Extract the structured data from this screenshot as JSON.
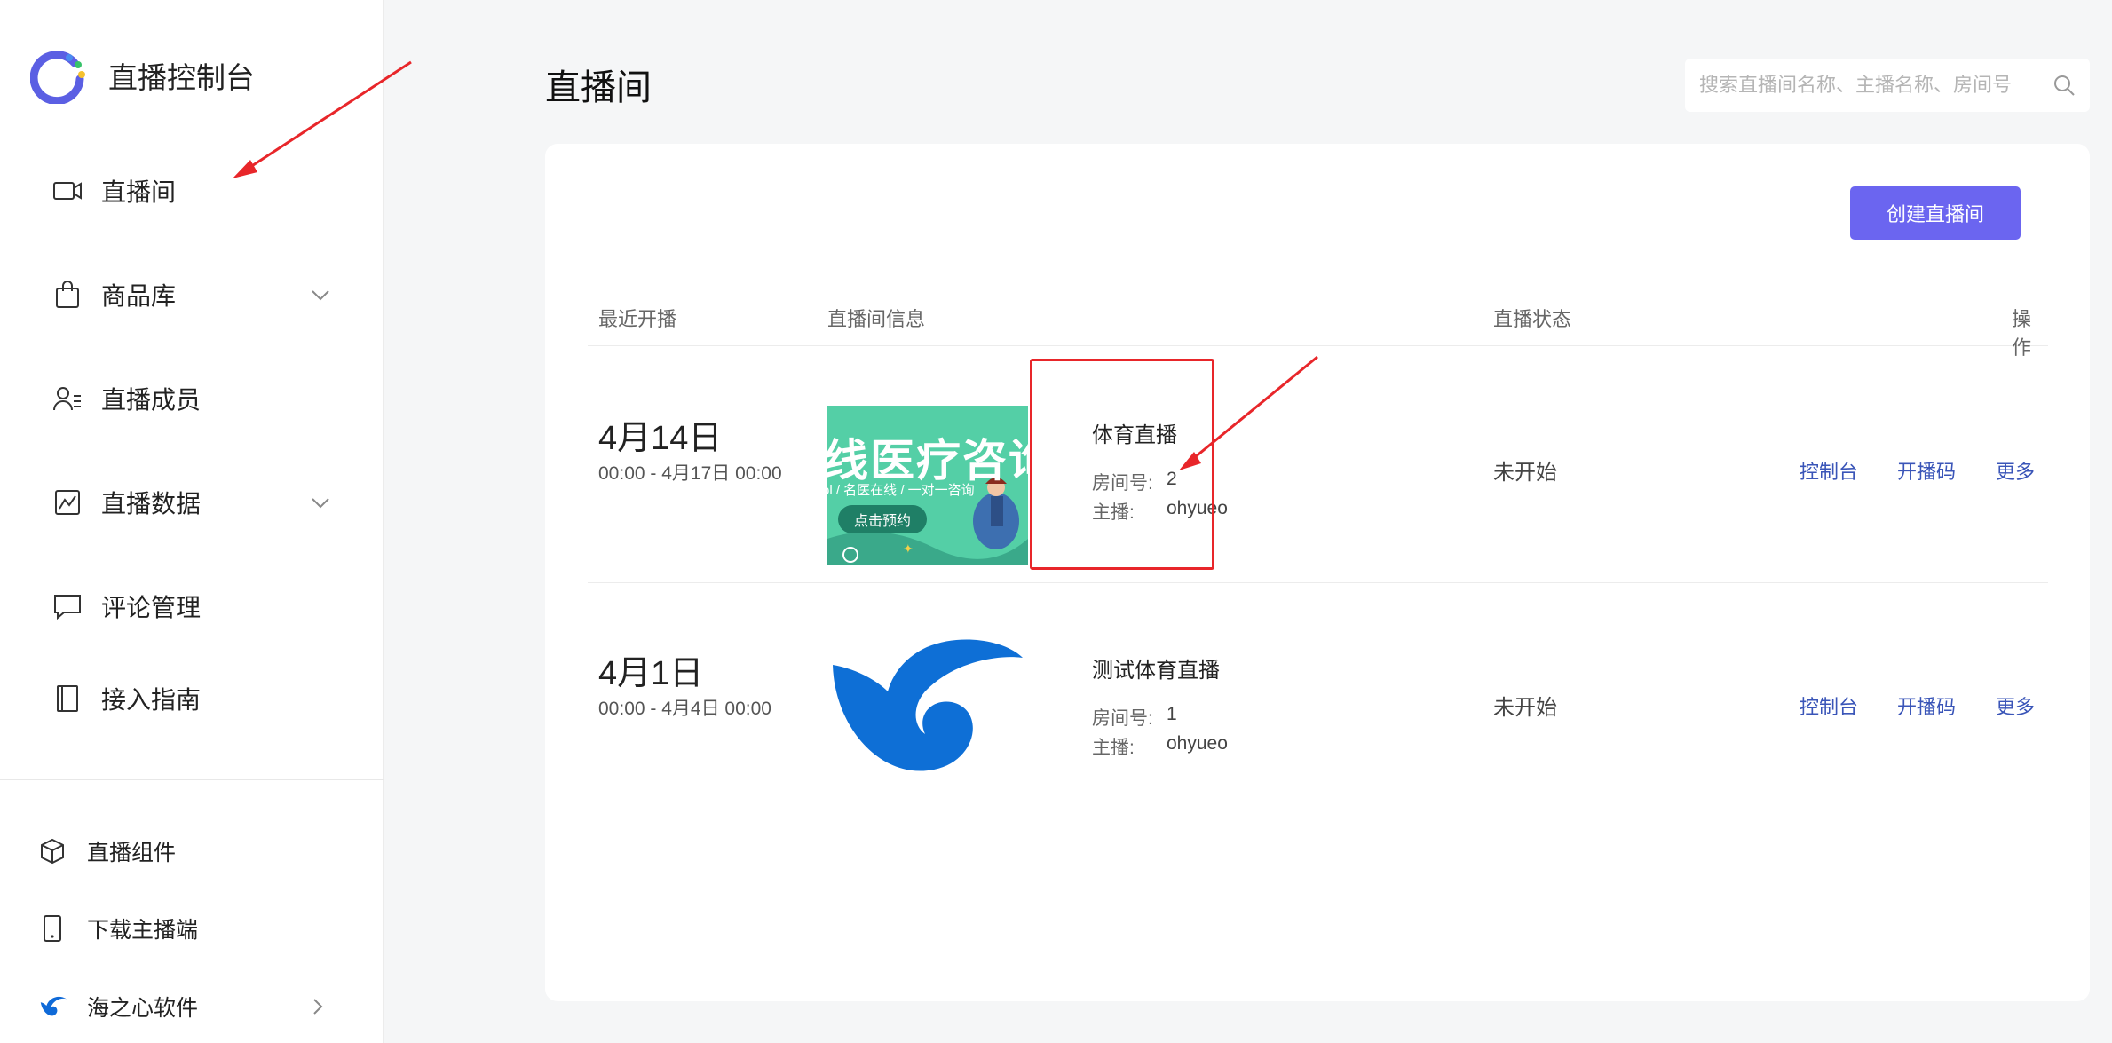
{
  "brand": {
    "title": "直播控制台",
    "colors": {
      "arc": "#5b5fe3",
      "dot_green": "#37c26a",
      "dot_yellow": "#f5c12e",
      "dot_blue": "#4a8df0"
    }
  },
  "sidebar": {
    "items": [
      {
        "label": "直播间",
        "icon": "video-camera-icon"
      },
      {
        "label": "商品库",
        "icon": "shopping-bag-icon",
        "expandable": true
      },
      {
        "label": "直播成员",
        "icon": "user-list-icon"
      },
      {
        "label": "直播数据",
        "icon": "chart-icon",
        "expandable": true
      },
      {
        "label": "评论管理",
        "icon": "comment-icon"
      },
      {
        "label": "接入指南",
        "icon": "book-icon"
      }
    ],
    "bottom": [
      {
        "label": "直播组件",
        "icon": "cube-icon"
      },
      {
        "label": "下载主播端",
        "icon": "phone-icon"
      },
      {
        "label": "海之心软件",
        "icon": "haizhixin-logo-icon"
      }
    ]
  },
  "header": {
    "title": "直播间",
    "search_placeholder": "搜索直播间名称、主播名称、房间号"
  },
  "actions": {
    "create_label": "创建直播间",
    "accent": "#6b65f0"
  },
  "table": {
    "columns": [
      "最近开播",
      "直播间信息",
      "直播状态",
      "操作"
    ],
    "rows": [
      {
        "date": "4月14日",
        "range": "00:00 - 4月17日 00:00",
        "thumb_banner": "线医疗咨询",
        "thumb_sub": "ol / 名医在线 / 一对一咨询",
        "thumb_btn": "点击预约",
        "name": "体育直播",
        "room_label": "房间号:",
        "room": "2",
        "host_label": "主播:",
        "host": "ohyueo",
        "status": "未开始",
        "ops": [
          "控制台",
          "开播码",
          "更多"
        ]
      },
      {
        "date": "4月1日",
        "range": "00:00 - 4月4日 00:00",
        "name": "测试体育直播",
        "room_label": "房间号:",
        "room": "1",
        "host_label": "主播:",
        "host": "ohyueo",
        "status": "未开始",
        "ops": [
          "控制台",
          "开播码",
          "更多"
        ]
      }
    ]
  },
  "annotation_color": "#e8262a"
}
